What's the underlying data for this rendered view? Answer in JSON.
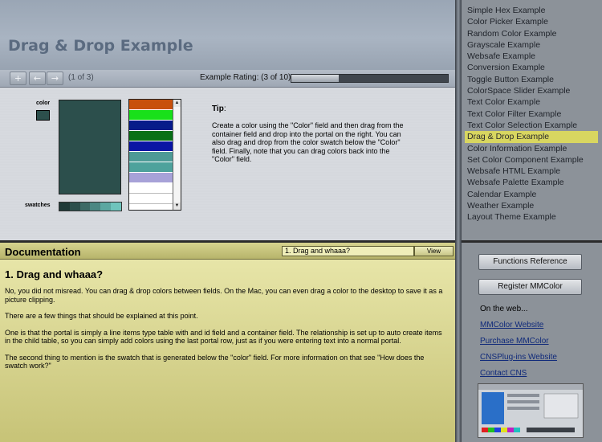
{
  "header": {
    "title": "Drag & Drop Example",
    "page_counter": "(1 of 3)",
    "rating_label": "Example Rating: (3 of 10)",
    "rating_value": 0.3,
    "icons": [
      "add-record-icon",
      "previous-arrow-icon",
      "next-arrow-icon"
    ]
  },
  "demo": {
    "color_label": "color",
    "swatches_label": "swatches",
    "selected_color": "#2c4f4c",
    "swatch_colors": [
      "#1f3a38",
      "#2c4f4c",
      "#3d6a66",
      "#4b8783",
      "#5ca7a1",
      "#6fc4bd"
    ],
    "portal_colors": [
      "#c8500c",
      "#19e01a",
      "#071b8a",
      "#0a7016",
      "#0a16a4",
      "#4d9a96",
      "#4ea29c",
      "#a7a2d8",
      "#ffffff",
      "#ffffff"
    ],
    "tip_label": "Tip",
    "tip_colon": ":",
    "tip_text": "Create a color using the \"Color\" field and then drag from the container field and drop into the portal on the right.  You can also drag and drop from the color swatch below the \"Color\" field.  Finally, note that you can drag colors back into the \"Color\" field."
  },
  "documentation": {
    "title": "Documentation",
    "topic_field": "1. Drag and whaaa?",
    "view_button": "View",
    "heading": "1. Drag and whaaa?",
    "paragraphs": [
      "No, you did not misread.  You can drag & drop colors between fields.  On the Mac, you can even drag a color to the desktop to save it as a picture clipping.",
      "There are a few things that should be explained at this point.",
      "One is that the portal is simply a line items type table with and id field and a container field.  The relationship is set up to auto create items in the child table, so you can simply add colors using the last portal row, just as if you were entering text into a normal portal.",
      "The second thing to mention is the swatch that is generated below the \"color\" field.  For more information on that see \"How does the swatch work?\""
    ]
  },
  "examples": {
    "items": [
      "Simple Hex Example",
      "Color Picker Example",
      "Random Color Example",
      "Grayscale Example",
      "Websafe Example",
      "Conversion Example",
      "Toggle Button Example",
      "ColorSpace Slider Example",
      "Text Color Example",
      "Text Color Filter Example",
      "Text Color Selection Example",
      "Drag & Drop Example",
      "Color Information Example",
      "Set Color Component Example",
      "Websafe HTML Example",
      "Websafe Palette Example",
      "Calendar Example",
      "Weather Example",
      "Layout Theme Example"
    ],
    "selected_index": 11,
    "highlight_color": "#d8d660"
  },
  "sidebar": {
    "functions_button": "Functions Reference",
    "register_button": "Register MMColor",
    "on_web_label": "On the web...",
    "links": [
      "MMColor Website",
      "Purchase MMColor",
      "CNSPlug-ins Website",
      "Contact CNS"
    ],
    "thumbnail_icon": "mmcolor-screenshot-thumbnail"
  }
}
